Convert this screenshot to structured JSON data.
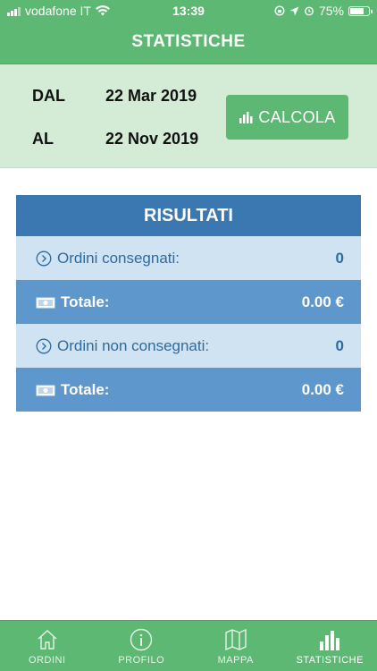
{
  "status_bar": {
    "carrier": "vodafone IT",
    "time": "13:39",
    "battery": "75%"
  },
  "nav": {
    "title": "STATISTICHE"
  },
  "date_panel": {
    "from_label": "DAL",
    "from_value": "22 Mar 2019",
    "to_label": "AL",
    "to_value": "22 Nov 2019",
    "button_label": "CALCOLA"
  },
  "results": {
    "title": "RISULTATI",
    "rows": [
      {
        "label": "Ordini consegnati:",
        "value": "0",
        "icon": "chevron-circle-icon"
      },
      {
        "label": "Totale:",
        "value": "0.00 €",
        "icon": "money-icon"
      },
      {
        "label": "Ordini non consegnati:",
        "value": "0",
        "icon": "chevron-circle-icon"
      },
      {
        "label": "Totale:",
        "value": "0.00 €",
        "icon": "money-icon"
      }
    ]
  },
  "tabs": [
    {
      "label": "ORDINI",
      "icon": "home-icon"
    },
    {
      "label": "PROFILO",
      "icon": "info-icon"
    },
    {
      "label": "MAPPA",
      "icon": "map-icon"
    },
    {
      "label": "STATISTICHE",
      "icon": "bar-chart-icon",
      "active": true
    }
  ],
  "colors": {
    "primary_green": "#5db873",
    "light_green": "#d4ecd6",
    "header_blue": "#3b77b0",
    "row_dark_blue": "#5e97cb",
    "row_light_blue": "#cfe3f3"
  }
}
